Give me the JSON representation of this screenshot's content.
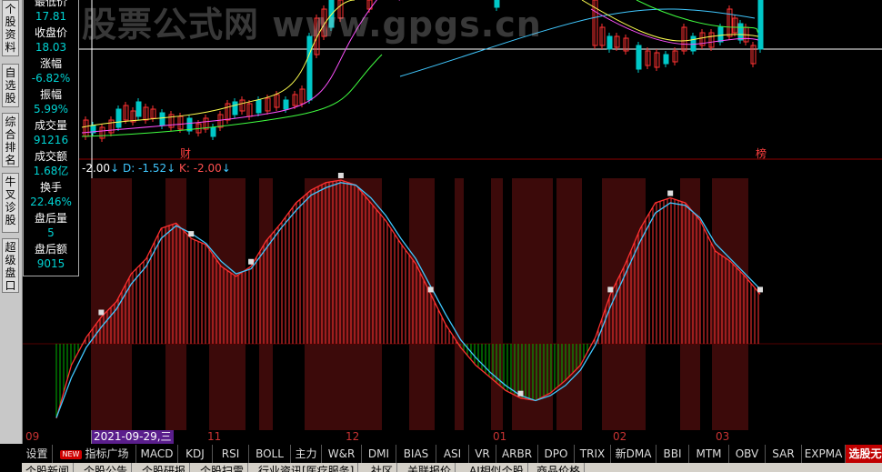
{
  "left_tabs": [
    {
      "label": "个股资料"
    },
    {
      "label": "自选股"
    },
    {
      "label": "综合排名"
    },
    {
      "label": "牛叉诊股"
    },
    {
      "label": "超级盘口"
    }
  ],
  "info_panel": [
    {
      "label": "最低价",
      "value": "17.81",
      "color": "cyan"
    },
    {
      "label": "收盘价",
      "value": "18.03",
      "color": "cyan"
    },
    {
      "label": "涨幅",
      "value": "-6.82%",
      "color": "cyan"
    },
    {
      "label": "振幅",
      "value": "5.99%",
      "color": "cyan"
    },
    {
      "label": "成交量",
      "value": "91216",
      "color": "cyan"
    },
    {
      "label": "成交额",
      "value": "1.68亿",
      "color": "cyan"
    },
    {
      "label": "换手",
      "value": "22.46%",
      "color": "cyan"
    },
    {
      "label": "盘后量",
      "value": "5",
      "color": "cyan"
    },
    {
      "label": "盘后额",
      "value": "9015",
      "color": "cyan"
    }
  ],
  "watermark": "股票公式网 www.gpgs.cn",
  "indicator": {
    "j_value": "-2.00",
    "d_label": "D: -1.52",
    "k_label": "K: -2.00",
    "arrow": "↓"
  },
  "event_markers": {
    "left": "财",
    "right": "榜"
  },
  "dates": {
    "cursor": "2021-09-29,三",
    "months": [
      "09",
      "11",
      "12",
      "01",
      "02",
      "03"
    ]
  },
  "indicator_tabs": [
    "设置",
    "指标广场",
    "MACD",
    "KDJ",
    "RSI",
    "BOLL",
    "主力",
    "W&R",
    "DMI",
    "BIAS",
    "ASI",
    "VR",
    "ARBR",
    "DPO",
    "TRIX",
    "新DMA",
    "BBI",
    "MTM",
    "OBV",
    "SAR",
    "EXPMA",
    "选股无忧"
  ],
  "new_badge": "NEW",
  "bottom_tabs": [
    "个股新闻",
    "个股公告",
    "个股研报",
    "个股扫雷",
    "行业资讯[医疗服务]",
    "社区",
    "关联报价",
    "AI相似个股",
    "商品价格"
  ],
  "colors": {
    "up": "#ff3232",
    "down": "#00c8c8",
    "volume_down": "#00b400",
    "k_line": "#ff3030",
    "d_line": "#40c8ff",
    "highlight_band": "#3c0a0a"
  },
  "chart_data": {
    "type": "line",
    "k_series": [
      -2,
      40,
      62,
      78,
      90,
      112,
      124,
      148,
      152,
      140,
      135,
      118,
      110,
      118,
      138,
      152,
      168,
      178,
      184,
      186,
      182,
      168,
      154,
      136,
      120,
      96,
      72,
      54,
      40,
      30,
      20,
      14,
      12,
      18,
      28,
      40,
      62,
      96,
      120,
      148,
      168,
      172,
      168,
      154,
      130,
      122,
      110,
      96
    ],
    "d_series": [
      -1.52,
      30,
      54,
      70,
      84,
      104,
      118,
      140,
      150,
      144,
      136,
      122,
      112,
      116,
      132,
      148,
      162,
      174,
      180,
      184,
      182,
      172,
      158,
      140,
      124,
      102,
      80,
      60,
      46,
      34,
      24,
      16,
      12,
      16,
      24,
      36,
      56,
      86,
      112,
      138,
      160,
      168,
      166,
      156,
      136,
      124,
      112,
      100
    ]
  }
}
